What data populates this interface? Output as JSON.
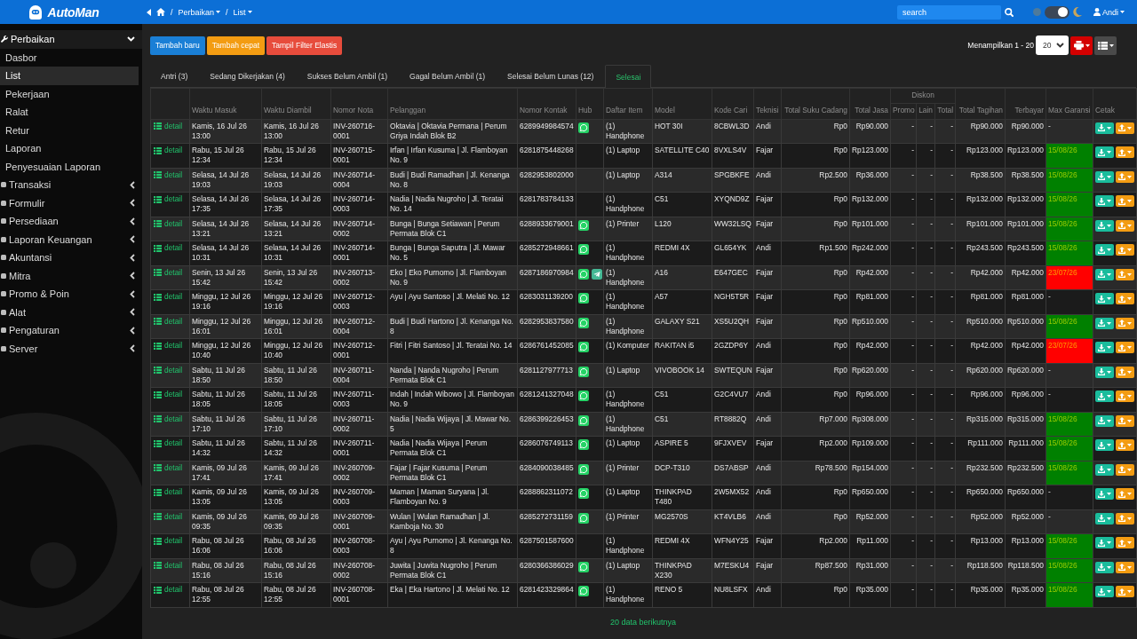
{
  "topbar": {
    "logo": "AutoMan",
    "breadcrumb": [
      {
        "kind": "back"
      },
      {
        "kind": "home"
      },
      {
        "kind": "separator",
        "text": "/"
      },
      {
        "kind": "link",
        "label": "Perbaikan",
        "dropdown": true
      },
      {
        "kind": "separator",
        "text": "/"
      },
      {
        "kind": "link",
        "label": "List",
        "dropdown": true
      }
    ],
    "search": {
      "placeholder": "search"
    },
    "dark_mode": true,
    "user": "Andi"
  },
  "sidebar": {
    "groups": [
      {
        "label": "Perbaikan",
        "expanded": true,
        "children": [
          {
            "label": "Dasbor",
            "selected": false
          },
          {
            "label": "List",
            "selected": true
          },
          {
            "label": "Pekerjaan",
            "selected": false
          },
          {
            "label": "Ralat",
            "selected": false
          },
          {
            "label": "Retur",
            "selected": false
          },
          {
            "label": "Laporan",
            "selected": false
          },
          {
            "label": "Penyesuaian Laporan",
            "selected": false
          }
        ]
      },
      {
        "label": "Transaksi",
        "expanded": false
      },
      {
        "label": "Formulir",
        "expanded": false
      },
      {
        "label": "Persediaan",
        "expanded": false
      },
      {
        "label": "Laporan Keuangan",
        "expanded": false
      },
      {
        "label": "Akuntansi",
        "expanded": false
      },
      {
        "label": "Mitra",
        "expanded": false
      },
      {
        "label": "Promo & Poin",
        "expanded": false
      },
      {
        "label": "Alat",
        "expanded": false
      },
      {
        "label": "Pengaturan",
        "expanded": false
      },
      {
        "label": "Server",
        "expanded": false
      }
    ]
  },
  "toolbar": {
    "buttons": [
      {
        "label": "Tambah baru",
        "kind": "primary"
      },
      {
        "label": "Tambah cepat",
        "kind": "warning"
      },
      {
        "label": "Tampil Filter Elastis",
        "kind": "danger"
      }
    ],
    "range": "Menampilkan 1 - 20",
    "page_size": "20"
  },
  "tabs": [
    {
      "label": "Antri (3)",
      "selected": false
    },
    {
      "label": "Sedang Dikerjakan (4)",
      "selected": false
    },
    {
      "label": "Sukses Belum Ambil (1)",
      "selected": false
    },
    {
      "label": "Gagal Belum Ambil (1)",
      "selected": false
    },
    {
      "label": "Selesai Belum Lunas (12)",
      "selected": false
    },
    {
      "label": "Selesai",
      "selected": true
    }
  ],
  "table": {
    "columns": [
      {
        "label": "Waktu Masuk"
      },
      {
        "label": "Waktu Diambil"
      },
      {
        "label": "Nomor Nota"
      },
      {
        "label": "Pelanggan"
      },
      {
        "label": "Nomor Kontak"
      },
      {
        "label": "Hub"
      },
      {
        "label": "Daftar Item"
      },
      {
        "label": "Model"
      },
      {
        "label": "Kode Cari"
      },
      {
        "label": "Teknisi"
      },
      {
        "label": "Total Suku Cadang"
      },
      {
        "label": "Total Jasa"
      },
      {
        "label": "Diskon",
        "children": [
          {
            "label": "Promo"
          },
          {
            "label": "Lain"
          },
          {
            "label": "Total"
          }
        ]
      },
      {
        "label": "Total Tagihan"
      },
      {
        "label": "Terbayar"
      },
      {
        "label": "Max Garansi"
      },
      {
        "label": "Cetak"
      }
    ],
    "rows": [
      {
        "action": "detail",
        "time_in": "Kamis, 16 Jul 26 13:00",
        "time_out": "Kamis, 16 Jul 26 13:00",
        "invoice": "INV-260716-0001",
        "customer": "Oktavia | Oktavia Permana | Perum Griya Indah Blok B2",
        "contact": "6289949984574",
        "hub": {
          "whatsapp": true,
          "telegram": false
        },
        "items": "(1) Handphone",
        "model": "HOT 30I",
        "search_code": "8CBWL3D",
        "technician": "Andi",
        "parts_total": "Rp0",
        "service_total": "Rp90.000",
        "promo": "-",
        "other": "-",
        "discount_total": "-",
        "bill_total": "Rp90.000",
        "paid": "Rp90.000",
        "warranty": {
          "text": "-"
        }
      },
      {
        "action": "detail",
        "time_in": "Rabu, 15 Jul 26 12:34",
        "time_out": "Rabu, 15 Jul 26 12:34",
        "invoice": "INV-260715-0001",
        "customer": "Irfan | Irfan Kusuma | Jl. Flamboyan No. 9",
        "contact": "6281875448268",
        "hub": {
          "whatsapp": false,
          "telegram": false
        },
        "items": "(1) Laptop",
        "model": "SATELLITE C40",
        "search_code": "8VXLS4V",
        "technician": "Fajar",
        "parts_total": "Rp0",
        "service_total": "Rp123.000",
        "promo": "-",
        "other": "-",
        "discount_total": "-",
        "bill_total": "Rp123.000",
        "paid": "Rp123.000",
        "warranty": {
          "text": "15/08/26",
          "color": "#008000"
        }
      },
      {
        "action": "detail",
        "time_in": "Selasa, 14 Jul 26 19:03",
        "time_out": "Selasa, 14 Jul 26 19:03",
        "invoice": "INV-260714-0004",
        "customer": "Budi | Budi Ramadhan | Jl. Kenanga No. 8",
        "contact": "6282953802000",
        "hub": {
          "whatsapp": false,
          "telegram": false
        },
        "items": "(1) Laptop",
        "model": "A314",
        "search_code": "SPGBKFE",
        "technician": "Andi",
        "parts_total": "Rp2.500",
        "service_total": "Rp36.000",
        "promo": "-",
        "other": "-",
        "discount_total": "-",
        "bill_total": "Rp38.500",
        "paid": "Rp38.500",
        "warranty": {
          "text": "15/08/26",
          "color": "#008000"
        }
      },
      {
        "action": "detail",
        "time_in": "Selasa, 14 Jul 26 17:35",
        "time_out": "Selasa, 14 Jul 26 17:35",
        "invoice": "INV-260714-0003",
        "customer": "Nadia | Nadia Nugroho | Jl. Teratai No. 14",
        "contact": "6281783784133",
        "hub": {
          "whatsapp": false,
          "telegram": false
        },
        "items": "(1) Handphone",
        "model": "C51",
        "search_code": "XYQND9Z",
        "technician": "Fajar",
        "parts_total": "Rp0",
        "service_total": "Rp132.000",
        "promo": "-",
        "other": "-",
        "discount_total": "-",
        "bill_total": "Rp132.000",
        "paid": "Rp132.000",
        "warranty": {
          "text": "15/08/26",
          "color": "#008000"
        }
      },
      {
        "action": "detail",
        "time_in": "Selasa, 14 Jul 26 13:21",
        "time_out": "Selasa, 14 Jul 26 13:21",
        "invoice": "INV-260714-0002",
        "customer": "Bunga | Bunga Setiawan | Perum Permata Blok C1",
        "contact": "6288933679001",
        "hub": {
          "whatsapp": true,
          "telegram": false
        },
        "items": "(1) Printer",
        "model": "L120",
        "search_code": "WW32LSQ",
        "technician": "Fajar",
        "parts_total": "Rp0",
        "service_total": "Rp101.000",
        "promo": "-",
        "other": "-",
        "discount_total": "-",
        "bill_total": "Rp101.000",
        "paid": "Rp101.000",
        "warranty": {
          "text": "15/08/26",
          "color": "#008000"
        }
      },
      {
        "action": "detail",
        "time_in": "Selasa, 14 Jul 26 10:31",
        "time_out": "Selasa, 14 Jul 26 10:31",
        "invoice": "INV-260714-0001",
        "customer": "Bunga | Bunga Saputra | Jl. Mawar No. 5",
        "contact": "6285272948661",
        "hub": {
          "whatsapp": true,
          "telegram": false
        },
        "items": "(1) Handphone",
        "model": "REDMI 4X",
        "search_code": "GL654YK",
        "technician": "Andi",
        "parts_total": "Rp1.500",
        "service_total": "Rp242.000",
        "promo": "-",
        "other": "-",
        "discount_total": "-",
        "bill_total": "Rp243.500",
        "paid": "Rp243.500",
        "warranty": {
          "text": "15/08/26",
          "color": "#008000"
        }
      },
      {
        "action": "detail",
        "time_in": "Senin, 13 Jul 26 15:42",
        "time_out": "Senin, 13 Jul 26 15:42",
        "invoice": "INV-260713-0002",
        "customer": "Eko | Eko Purnomo | Jl. Flamboyan No. 9",
        "contact": "6287186970984",
        "hub": {
          "whatsapp": true,
          "telegram": true
        },
        "items": "(1) Handphone",
        "model": "A16",
        "search_code": "E647GEC",
        "technician": "Fajar",
        "parts_total": "Rp0",
        "service_total": "Rp42.000",
        "promo": "-",
        "other": "-",
        "discount_total": "-",
        "bill_total": "Rp42.000",
        "paid": "Rp42.000",
        "warranty": {
          "text": "23/07/26",
          "color": "#ff0000"
        }
      },
      {
        "action": "detail",
        "time_in": "Minggu, 12 Jul 26 19:16",
        "time_out": "Minggu, 12 Jul 26 19:16",
        "invoice": "INV-260712-0003",
        "customer": "Ayu | Ayu Santoso | Jl. Melati No. 12",
        "contact": "6283031139200",
        "hub": {
          "whatsapp": true,
          "telegram": false
        },
        "items": "(1) Handphone",
        "model": "A57",
        "search_code": "NGH5T5R",
        "technician": "Fajar",
        "parts_total": "Rp0",
        "service_total": "Rp81.000",
        "promo": "-",
        "other": "-",
        "discount_total": "-",
        "bill_total": "Rp81.000",
        "paid": "Rp81.000",
        "warranty": {
          "text": "-"
        }
      },
      {
        "action": "detail",
        "time_in": "Minggu, 12 Jul 26 16:01",
        "time_out": "Minggu, 12 Jul 26 16:01",
        "invoice": "INV-260712-0004",
        "customer": "Budi | Budi Hartono | Jl. Kenanga No. 8",
        "contact": "6282953837580",
        "hub": {
          "whatsapp": true,
          "telegram": false
        },
        "items": "(1) Handphone",
        "model": "GALAXY S21",
        "search_code": "XS5U2QH",
        "technician": "Fajar",
        "parts_total": "Rp0",
        "service_total": "Rp510.000",
        "promo": "-",
        "other": "-",
        "discount_total": "-",
        "bill_total": "Rp510.000",
        "paid": "Rp510.000",
        "warranty": {
          "text": "15/08/26",
          "color": "#008000"
        }
      },
      {
        "action": "detail",
        "time_in": "Minggu, 12 Jul 26 10:40",
        "time_out": "Minggu, 12 Jul 26 10:40",
        "invoice": "INV-260712-0001",
        "customer": "Fitri | Fitri Santoso | Jl. Teratai No. 14",
        "contact": "6286761452085",
        "hub": {
          "whatsapp": true,
          "telegram": false
        },
        "items": "(1) Komputer",
        "model": "RAKITAN i5",
        "search_code": "2GZDP6Y",
        "technician": "Andi",
        "parts_total": "Rp0",
        "service_total": "Rp42.000",
        "promo": "-",
        "other": "-",
        "discount_total": "-",
        "bill_total": "Rp42.000",
        "paid": "Rp42.000",
        "warranty": {
          "text": "23/07/26",
          "color": "#ff0000"
        }
      },
      {
        "action": "detail",
        "time_in": "Sabtu, 11 Jul 26 18:50",
        "time_out": "Sabtu, 11 Jul 26 18:50",
        "invoice": "INV-260711-0004",
        "customer": "Nanda | Nanda Nugroho | Perum Permata Blok C1",
        "contact": "6281127977713",
        "hub": {
          "whatsapp": true,
          "telegram": false
        },
        "items": "(1) Laptop",
        "model": "VIVOBOOK 14",
        "search_code": "SWTEQUN",
        "technician": "Fajar",
        "parts_total": "Rp0",
        "service_total": "Rp620.000",
        "promo": "-",
        "other": "-",
        "discount_total": "-",
        "bill_total": "Rp620.000",
        "paid": "Rp620.000",
        "warranty": {
          "text": "-"
        }
      },
      {
        "action": "detail",
        "time_in": "Sabtu, 11 Jul 26 18:05",
        "time_out": "Sabtu, 11 Jul 26 18:05",
        "invoice": "INV-260711-0003",
        "customer": "Indah | Indah Wibowo | Jl. Flamboyan No. 9",
        "contact": "6281241327048",
        "hub": {
          "whatsapp": true,
          "telegram": false
        },
        "items": "(1) Handphone",
        "model": "C51",
        "search_code": "G2C4VU7",
        "technician": "Andi",
        "parts_total": "Rp0",
        "service_total": "Rp96.000",
        "promo": "-",
        "other": "-",
        "discount_total": "-",
        "bill_total": "Rp96.000",
        "paid": "Rp96.000",
        "warranty": {
          "text": "-"
        }
      },
      {
        "action": "detail",
        "time_in": "Sabtu, 11 Jul 26 17:10",
        "time_out": "Sabtu, 11 Jul 26 17:10",
        "invoice": "INV-260711-0002",
        "customer": "Nadia | Nadia Wijaya | Jl. Mawar No. 5",
        "contact": "6286399226453",
        "hub": {
          "whatsapp": true,
          "telegram": false
        },
        "items": "(1) Handphone",
        "model": "C51",
        "search_code": "RT8882Q",
        "technician": "Andi",
        "parts_total": "Rp7.000",
        "service_total": "Rp308.000",
        "promo": "-",
        "other": "-",
        "discount_total": "-",
        "bill_total": "Rp315.000",
        "paid": "Rp315.000",
        "warranty": {
          "text": "15/08/26",
          "color": "#008000"
        }
      },
      {
        "action": "detail",
        "time_in": "Sabtu, 11 Jul 26 14:32",
        "time_out": "Sabtu, 11 Jul 26 14:32",
        "invoice": "INV-260711-0001",
        "customer": "Nadia | Nadia Wijaya | Perum Permata Blok C1",
        "contact": "6286076749113",
        "hub": {
          "whatsapp": true,
          "telegram": false
        },
        "items": "(1) Laptop",
        "model": "ASPIRE 5",
        "search_code": "9FJXVEV",
        "technician": "Fajar",
        "parts_total": "Rp2.000",
        "service_total": "Rp109.000",
        "promo": "-",
        "other": "-",
        "discount_total": "-",
        "bill_total": "Rp111.000",
        "paid": "Rp111.000",
        "warranty": {
          "text": "15/08/26",
          "color": "#008000"
        }
      },
      {
        "action": "detail",
        "time_in": "Kamis, 09 Jul 26 17:41",
        "time_out": "Kamis, 09 Jul 26 17:41",
        "invoice": "INV-260709-0002",
        "customer": "Fajar | Fajar Kusuma | Perum Permata Blok C1",
        "contact": "6284090038485",
        "hub": {
          "whatsapp": true,
          "telegram": false
        },
        "items": "(1) Printer",
        "model": "DCP-T310",
        "search_code": "DS7ABSP",
        "technician": "Andi",
        "parts_total": "Rp78.500",
        "service_total": "Rp154.000",
        "promo": "-",
        "other": "-",
        "discount_total": "-",
        "bill_total": "Rp232.500",
        "paid": "Rp232.500",
        "warranty": {
          "text": "15/08/26",
          "color": "#008000"
        }
      },
      {
        "action": "detail",
        "time_in": "Kamis, 09 Jul 26 13:05",
        "time_out": "Kamis, 09 Jul 26 13:05",
        "invoice": "INV-260709-0003",
        "customer": "Maman | Maman Suryana | Jl. Flamboyan No. 9",
        "contact": "6288862311072",
        "hub": {
          "whatsapp": true,
          "telegram": false
        },
        "items": "(1) Laptop",
        "model": "THINKPAD T480",
        "search_code": "2W5MX52",
        "technician": "Andi",
        "parts_total": "Rp0",
        "service_total": "Rp650.000",
        "promo": "-",
        "other": "-",
        "discount_total": "-",
        "bill_total": "Rp650.000",
        "paid": "Rp650.000",
        "warranty": {
          "text": "-"
        }
      },
      {
        "action": "detail",
        "time_in": "Kamis, 09 Jul 26 09:35",
        "time_out": "Kamis, 09 Jul 26 09:35",
        "invoice": "INV-260709-0001",
        "customer": "Wulan | Wulan Ramadhan | Jl. Kamboja No. 30",
        "contact": "6285272731159",
        "hub": {
          "whatsapp": true,
          "telegram": false
        },
        "items": "(1) Printer",
        "model": "MG2570S",
        "search_code": "KT4VLB6",
        "technician": "Andi",
        "parts_total": "Rp0",
        "service_total": "Rp52.000",
        "promo": "-",
        "other": "-",
        "discount_total": "-",
        "bill_total": "Rp52.000",
        "paid": "Rp52.000",
        "warranty": {
          "text": "-"
        }
      },
      {
        "action": "detail",
        "time_in": "Rabu, 08 Jul 26 16:06",
        "time_out": "Rabu, 08 Jul 26 16:06",
        "invoice": "INV-260708-0003",
        "customer": "Ayu | Ayu Purnomo | Jl. Kenanga No. 8",
        "contact": "6287501587600",
        "hub": {
          "whatsapp": false,
          "telegram": false
        },
        "items": "(1) Handphone",
        "model": "REDMI 4X",
        "search_code": "WFN4Y25",
        "technician": "Fajar",
        "parts_total": "Rp2.000",
        "service_total": "Rp11.000",
        "promo": "-",
        "other": "-",
        "discount_total": "-",
        "bill_total": "Rp13.000",
        "paid": "Rp13.000",
        "warranty": {
          "text": "15/08/26",
          "color": "#008000"
        }
      },
      {
        "action": "detail",
        "time_in": "Rabu, 08 Jul 26 15:16",
        "time_out": "Rabu, 08 Jul 26 15:16",
        "invoice": "INV-260708-0002",
        "customer": "Juwita | Juwita Nugroho | Perum Permata Blok C1",
        "contact": "6280366386029",
        "hub": {
          "whatsapp": true,
          "telegram": false
        },
        "items": "(1) Laptop",
        "model": "THINKPAD X230",
        "search_code": "M7ESKU4",
        "technician": "Fajar",
        "parts_total": "Rp87.500",
        "service_total": "Rp31.000",
        "promo": "-",
        "other": "-",
        "discount_total": "-",
        "bill_total": "Rp118.500",
        "paid": "Rp118.500",
        "warranty": {
          "text": "15/08/26",
          "color": "#008000"
        }
      },
      {
        "action": "detail",
        "time_in": "Rabu, 08 Jul 26 12:55",
        "time_out": "Rabu, 08 Jul 26 12:55",
        "invoice": "INV-260708-0001",
        "customer": "Eka | Eka Hartono | Jl. Melati No. 12",
        "contact": "6281423329864",
        "hub": {
          "whatsapp": true,
          "telegram": false
        },
        "items": "(1) Handphone",
        "model": "RENO 5",
        "search_code": "NU8LSFX",
        "technician": "Andi",
        "parts_total": "Rp0",
        "service_total": "Rp35.000",
        "promo": "-",
        "other": "-",
        "discount_total": "-",
        "bill_total": "Rp35.000",
        "paid": "Rp35.000",
        "warranty": {
          "text": "15/08/26",
          "color": "#008000"
        }
      }
    ]
  },
  "pager": {
    "next": "20 data berikutnya"
  }
}
